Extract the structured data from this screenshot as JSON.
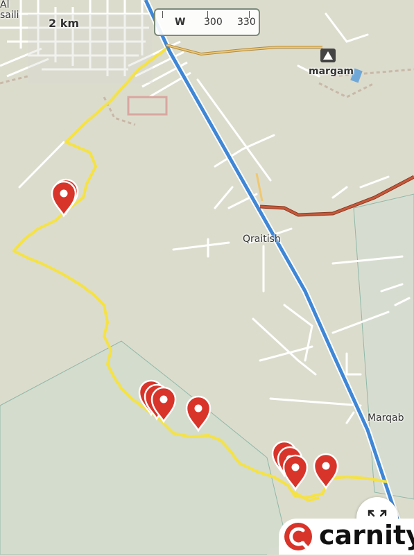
{
  "map": {
    "scale_label": "2 km",
    "places": {
      "top_left": "Al\nsaili",
      "margam": "margam",
      "qraitish": "Qraitish",
      "marqab": "Marqab"
    },
    "compass": {
      "direction": "W",
      "degree_1": "300",
      "degree_2": "330"
    },
    "route_color": "#f5e245",
    "highway_color": "#3f87d6",
    "road_color": "#c7583a",
    "marker_color": "#d8342a",
    "marker_count": 10
  },
  "brand": {
    "name": "carnity",
    "logo_icon": "carnity-logo-icon",
    "logo_color": "#d8342a"
  },
  "controls": {
    "expand_icon": "expand-arrows-icon"
  }
}
